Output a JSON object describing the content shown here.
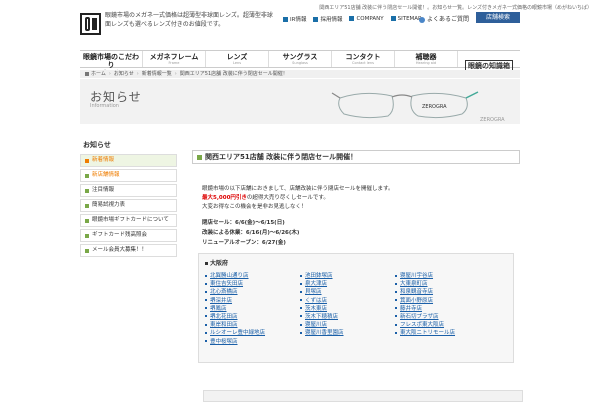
{
  "header": {
    "logo_text": "眼鏡市場",
    "tagline": "眼鏡市場のメガネ一式価格は超薄型非球面レンズ。超薄型非球面レンズも選べるレンズ付きのお値段です。",
    "top_text": "関西エリア51店舗 改装に伴う閉店セール開催！。お知らせ一覧。レンズ付きメガネ一式価格の眼鏡市場（めがねいちば）",
    "links": [
      {
        "label": "IR情報"
      },
      {
        "label": "採用情報"
      },
      {
        "label": "COMPANY"
      },
      {
        "label": "SITEMAP"
      }
    ],
    "faq_label": "よくあるご質問",
    "store_button": "店舗検索"
  },
  "nav": {
    "items": [
      {
        "label": "眼鏡市場のこだわり",
        "sub": "Concept"
      },
      {
        "label": "メガネフレーム",
        "sub": "Frame"
      },
      {
        "label": "レンズ",
        "sub": "Lens"
      },
      {
        "label": "サングラス",
        "sub": "Sunglass"
      },
      {
        "label": "コンタクト",
        "sub": "Contact lens"
      },
      {
        "label": "補聴器",
        "sub": "Hearing aid"
      }
    ],
    "chieki_label": "眼鏡の知識箱"
  },
  "breadcrumb": {
    "home": "ホーム",
    "level1": "お知らせ",
    "level2": "新着情報一覧",
    "current": "関西エリア51店舗 改装に伴う閉店セール開催！"
  },
  "hero": {
    "title": "お知らせ",
    "subtitle": "Information",
    "glasses_label": "ZEROGRA",
    "brand": "ZEROGRA"
  },
  "sidebar": {
    "heading": "お知らせ",
    "items": [
      {
        "label": "新着情報"
      },
      {
        "label": "新店舗情報"
      },
      {
        "label": "注目情報"
      },
      {
        "label": "簡易試視力表"
      },
      {
        "label": "眼鏡市場ギフトカードについて"
      },
      {
        "label": "ギフトカード残高照会"
      },
      {
        "label": "メール会員大募集！！"
      }
    ]
  },
  "article": {
    "title": "関西エリア51店舗 改装に伴う閉店セール開催！",
    "p1": "眼鏡市場の以下店舗におきまして、店舗改装に伴う閉店セールを開催します。",
    "p2_red": "最大5,000円引き",
    "p2_rest": "の超得大売り尽くしセールです。",
    "p3": "大変お得なこの機会を是非お見逃しなく！",
    "sale_period": "閉店セール：6/6(金)〜6/15(日)",
    "closed_period": "改装による休業：6/16(月)〜6/26(木)",
    "reopen": "リニューアルオープン：6/27(金)",
    "region": "大阪府",
    "shops_col1": [
      "北巽勝山通り店",
      "東住吉矢田店",
      "北心斎橋店",
      "堺深井店",
      "堺鳳店",
      "堺北花田店",
      "東岸和田店",
      "ルシオーレ豊中緑地店",
      "豊中桜塚店"
    ],
    "shops_col2": [
      "池田鉢塚店",
      "泉大津店",
      "貝塚店",
      "くずは店",
      "茨木東店",
      "茨木下穂積店",
      "寝屋川店",
      "寝屋川香里園店"
    ],
    "shops_col3": [
      "寝屋川宇谷店",
      "大東泉町店",
      "和泉観音寺店",
      "箕面小野原店",
      "藤井寺店",
      "新石切プラザ店",
      "フレスポ東大阪店",
      "東大阪ニトリモール店"
    ]
  }
}
